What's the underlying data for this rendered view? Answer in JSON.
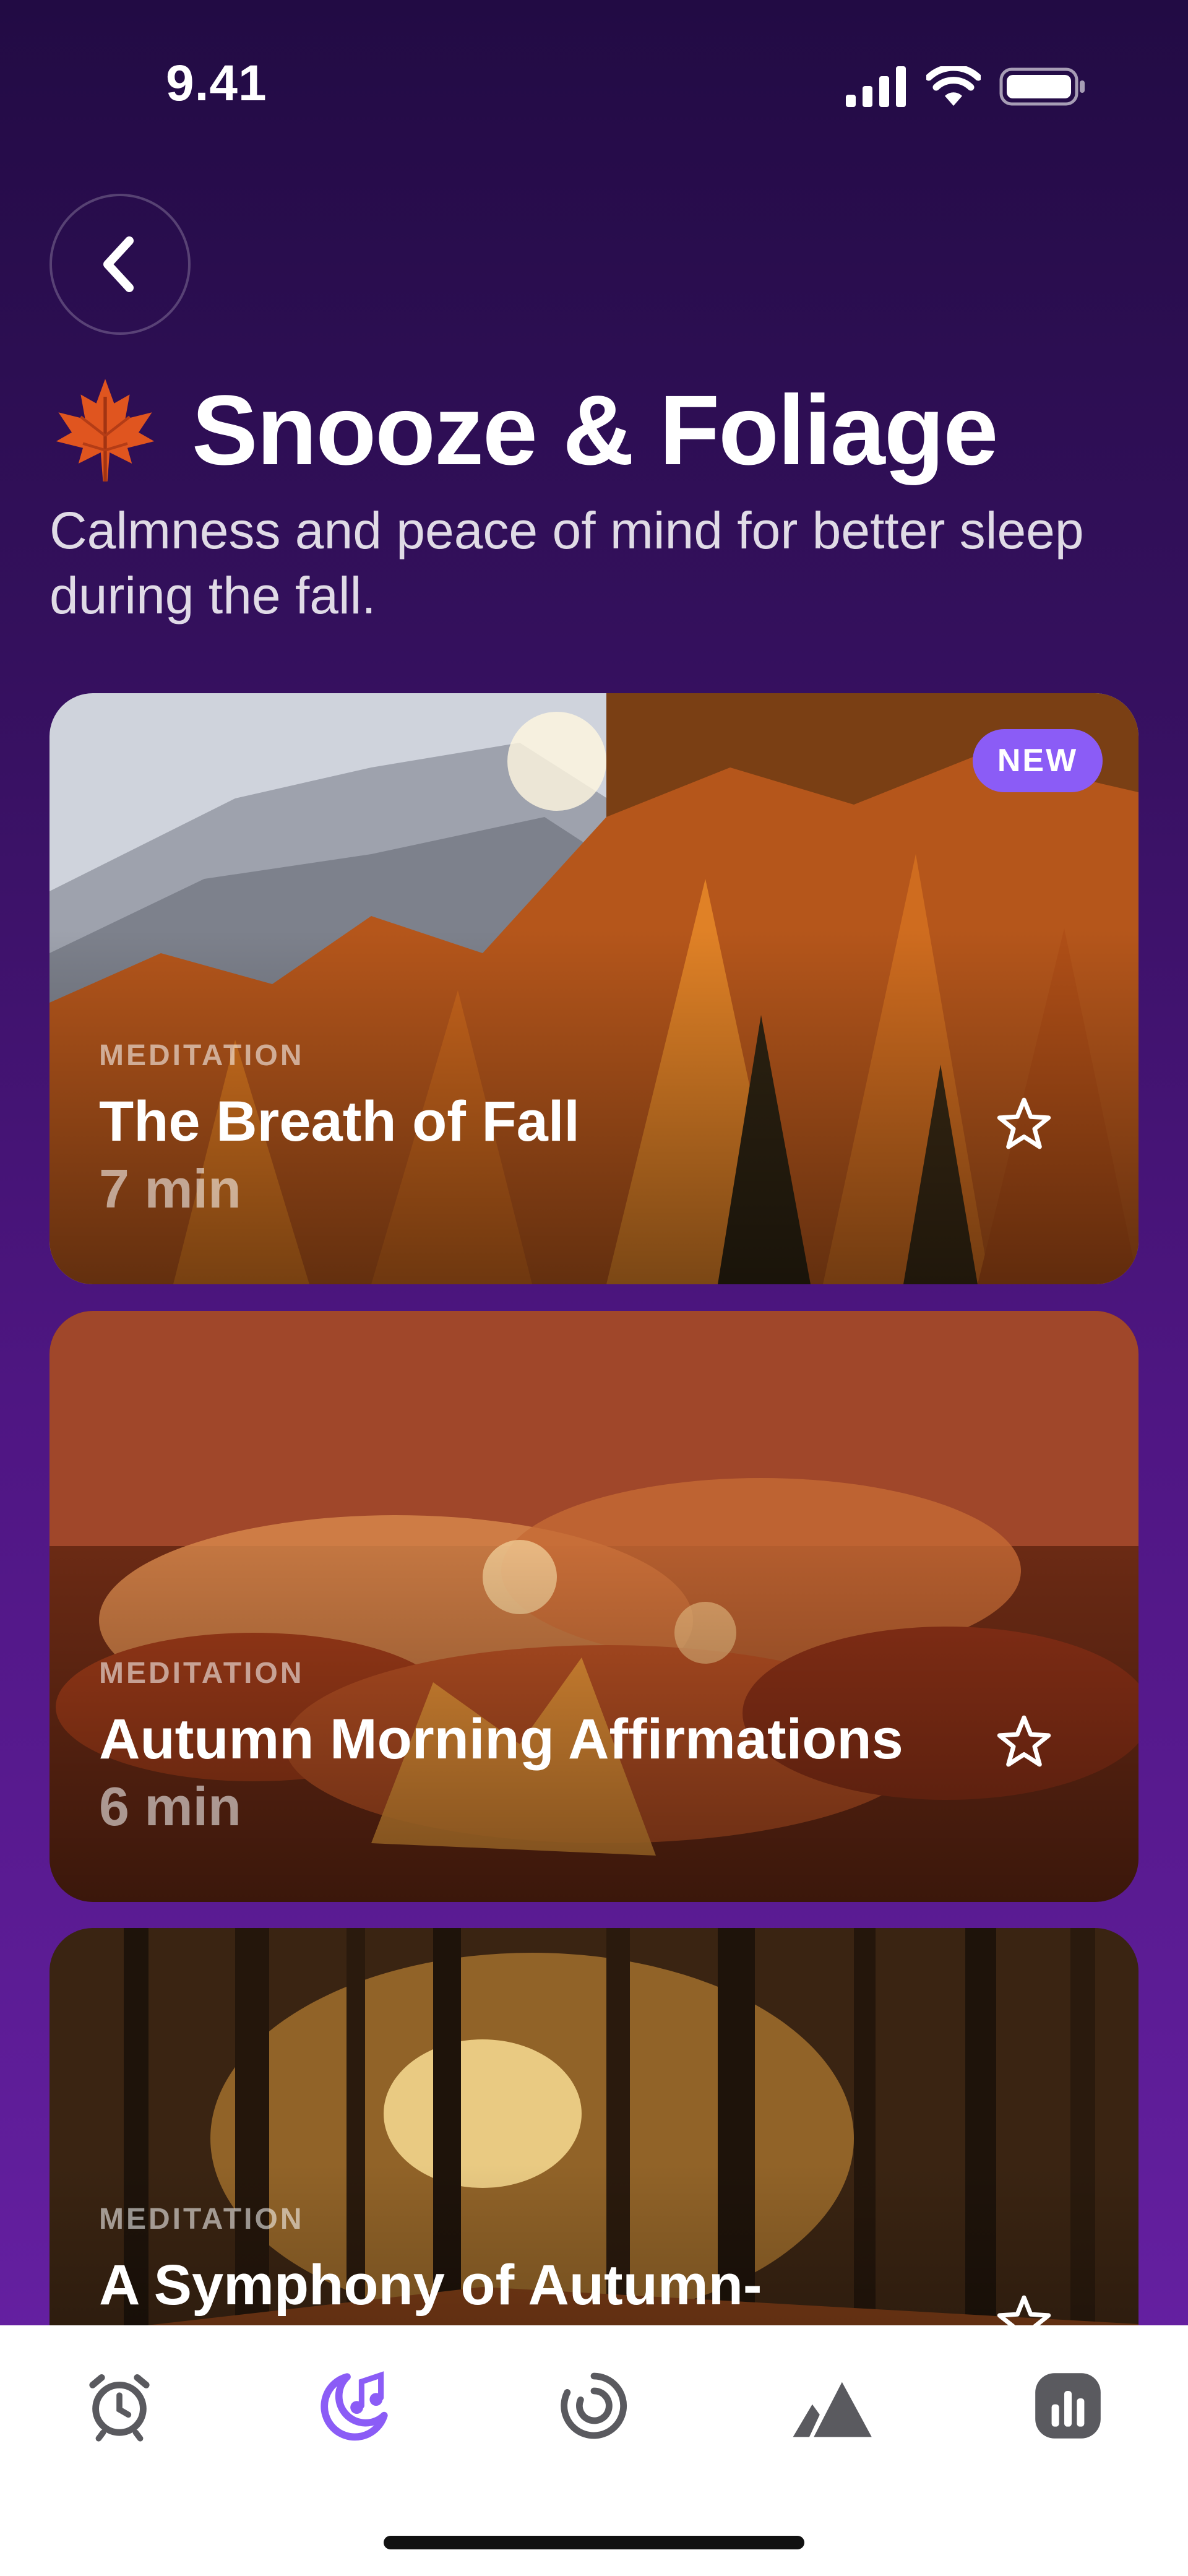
{
  "status_bar": {
    "time": "9.41",
    "icons": [
      "signal-icon",
      "wifi-icon",
      "battery-icon"
    ]
  },
  "header": {
    "back_icon": "chevron-left-icon",
    "leaf_icon": "maple-leaf-icon",
    "title": "Snooze & Foliage",
    "subtitle": "Calmness and peace of mind for better sleep during the fall."
  },
  "cards": [
    {
      "category": "MEDITATION",
      "title": "The Breath of Fall",
      "duration": "7 min",
      "badge": "NEW",
      "favorite_icon": "star-outline-icon"
    },
    {
      "category": "MEDITATION",
      "title": "Autumn Morning Affirmations",
      "duration": "6 min",
      "favorite_icon": "star-outline-icon"
    },
    {
      "category": "MEDITATION",
      "title": "A Symphony of Autumn-",
      "favorite_icon": "star-outline-icon"
    }
  ],
  "tab_bar": {
    "active_index": 1,
    "tabs": [
      {
        "icon": "alarm-clock-icon"
      },
      {
        "icon": "sleep-moon-icon"
      },
      {
        "icon": "breathing-circle-icon"
      },
      {
        "icon": "mountain-icon"
      },
      {
        "icon": "stats-icon"
      }
    ]
  },
  "colors": {
    "accent": "#8b5cf6",
    "tab_active": "#8b5cf6",
    "tab_inactive": "#5a5a5f"
  }
}
